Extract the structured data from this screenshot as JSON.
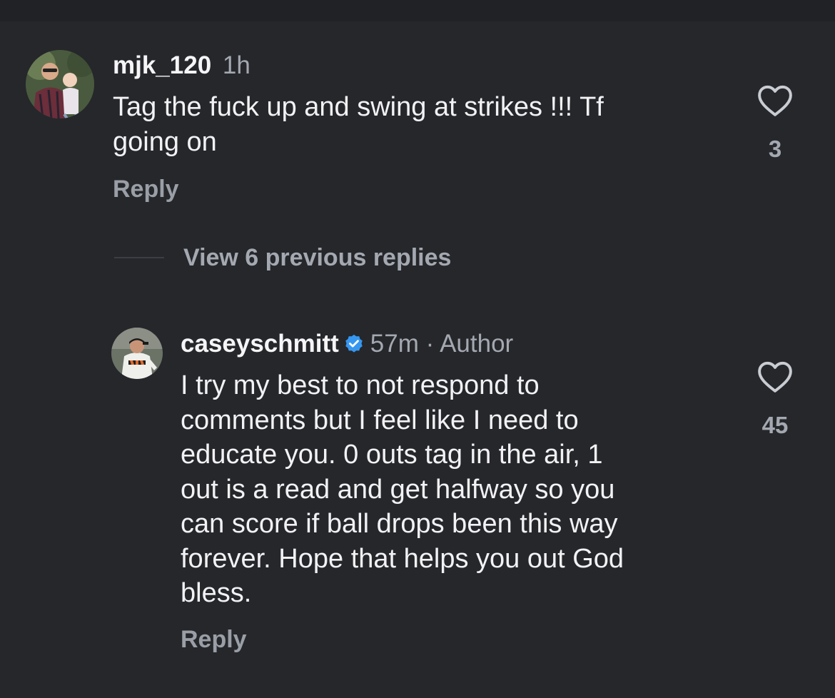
{
  "comments": [
    {
      "username": "mjk_120",
      "time": "1h",
      "text_lines": [
        "Tag the fuck up and swing at strikes !!! Tf",
        "going on"
      ],
      "reply_label": "Reply",
      "likes": "3",
      "verified": false
    },
    {
      "username": "caseyschmitt",
      "time": "57m",
      "separator": "·",
      "role": "Author",
      "text_lines": [
        "I try my best to not respond to",
        "comments but I feel like I need to",
        "educate you. 0 outs tag in the air, 1",
        "out is a read and get halfway so you",
        "can score if ball drops been this way",
        "forever. Hope that helps you out God",
        "bless."
      ],
      "reply_label": "Reply",
      "likes": "45",
      "verified": true
    }
  ],
  "view_replies_label": "View 6 previous replies",
  "icons": {
    "like": "heart-outline-icon",
    "verified": "verified-badge-icon"
  },
  "colors": {
    "background": "#25272b",
    "verified_blue": "#3797f0",
    "muted_text": "#a4a8b0"
  }
}
